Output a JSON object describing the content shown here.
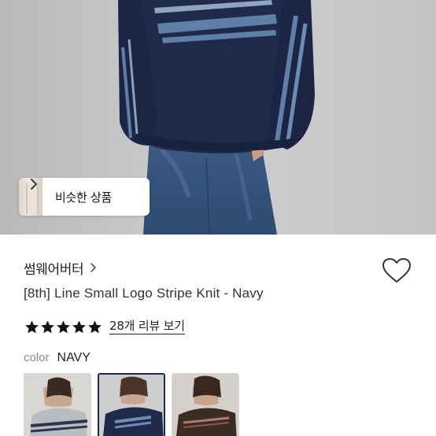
{
  "similar": {
    "label": "비슷한 상품"
  },
  "product": {
    "brand": "썸웨어버터",
    "title": "[8th] Line Small Logo Stripe Knit - Navy",
    "rating": 5,
    "review_link": "28개 리뷰 보기"
  },
  "color": {
    "label": "color",
    "value": "NAVY",
    "options": [
      {
        "name": "gray"
      },
      {
        "name": "navy",
        "selected": true
      },
      {
        "name": "brown"
      }
    ]
  },
  "colors": {
    "knit_navy": "#1f2a4a",
    "stripe_blue": "#5f7fa8",
    "denim": "#3d5c86",
    "star": "#111111",
    "heart_stroke": "#333333"
  }
}
